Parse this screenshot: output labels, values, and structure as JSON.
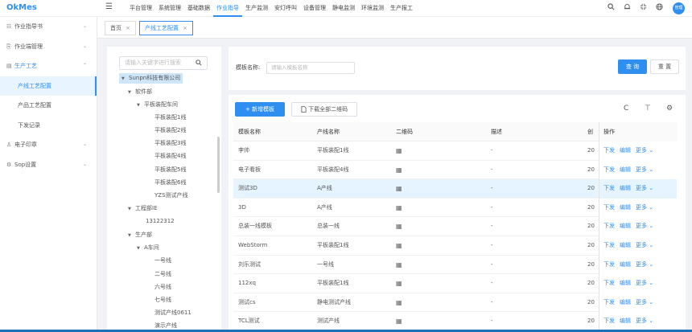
{
  "app": {
    "logo": "OkMes"
  },
  "topnav": {
    "menu_icon": "☰",
    "items": [
      "平台管理",
      "系统管理",
      "基础数据",
      "作业指导",
      "生产监测",
      "安灯呼叫",
      "设备管理",
      "静电监测",
      "环境监测",
      "生产报工"
    ],
    "active_index": 3
  },
  "topright": {
    "avatar": "管理"
  },
  "sidebar": {
    "items": [
      {
        "label": "作业指导书",
        "icon": "☷",
        "chev": "⌄"
      },
      {
        "label": "作业端管理",
        "icon": "⎘",
        "chev": "⌄"
      },
      {
        "label": "生产工艺",
        "icon": "▤",
        "chev": "⌃"
      },
      {
        "label": "产线工艺配置"
      },
      {
        "label": "产品工艺配置"
      },
      {
        "label": "下发记录"
      },
      {
        "label": "电子印章",
        "icon": "♙",
        "chev": "⌄"
      },
      {
        "label": "Sop设置",
        "icon": "⚙",
        "chev": "⌄"
      }
    ]
  },
  "tabs": [
    {
      "label": "首页",
      "close": "×"
    },
    {
      "label": "产线工艺配置",
      "close": "×"
    }
  ],
  "tree": {
    "search_placeholder": "请输入关键字进行搜索",
    "nodes": [
      {
        "label": "Sunpn科技有限公司",
        "caret": "▼"
      },
      {
        "label": "软件部",
        "caret": "▼"
      },
      {
        "label": "平板装配车间",
        "caret": "▼"
      },
      {
        "label": "平板装配1线"
      },
      {
        "label": "平板装配2线"
      },
      {
        "label": "平板装配3线"
      },
      {
        "label": "平板装配4线"
      },
      {
        "label": "平板装配5线"
      },
      {
        "label": "平板装配6线"
      },
      {
        "label": "YZS测试产线"
      },
      {
        "label": "工程部IE",
        "caret": "▼"
      },
      {
        "label": "13122312"
      },
      {
        "label": "生产部",
        "caret": "▼"
      },
      {
        "label": "A车间",
        "caret": "▼"
      },
      {
        "label": "一号线"
      },
      {
        "label": "二号线"
      },
      {
        "label": "六号线"
      },
      {
        "label": "七号线"
      },
      {
        "label": "测试产线0611"
      },
      {
        "label": "演示产线"
      }
    ]
  },
  "search": {
    "label": "模板名称:",
    "placeholder": "请输入模板名称",
    "query_button": "查 询",
    "reset_button": "重 置"
  },
  "toolbar": {
    "add_button": "+ 新增模板",
    "download_button": "下载全部二维码",
    "refresh_icon": "C",
    "column_icon": "⊤",
    "settings_icon": "⚙"
  },
  "table": {
    "headers": [
      "模板名称",
      "产线名称",
      "二维码",
      "描述",
      "创",
      "操作"
    ],
    "rows": [
      [
        "李帅",
        "平板装配1线",
        "-",
        "20"
      ],
      [
        "电子看板",
        "平板装配4线",
        "-",
        "20"
      ],
      [
        "测试3D",
        "A产线",
        "-",
        "20"
      ],
      [
        "3D",
        "A产线",
        "-",
        "20"
      ],
      [
        "总装一线模板",
        "总装一线",
        "-",
        "20"
      ],
      [
        "WebStorm",
        "平板装配1线",
        "-",
        "20"
      ],
      [
        "刘乐测试",
        "一号线",
        "-",
        "20"
      ],
      [
        "112xq",
        "平板装配1线",
        "-",
        "20"
      ],
      [
        "测试cs",
        "静电测试产线",
        "-",
        "20"
      ],
      [
        "TCL测试",
        "测试产线",
        "-",
        "20"
      ]
    ],
    "highlight_row": 2,
    "qr_glyph": "▦",
    "actions": {
      "issue": "下发",
      "edit": "编辑",
      "more": "更多 ⌄"
    }
  }
}
